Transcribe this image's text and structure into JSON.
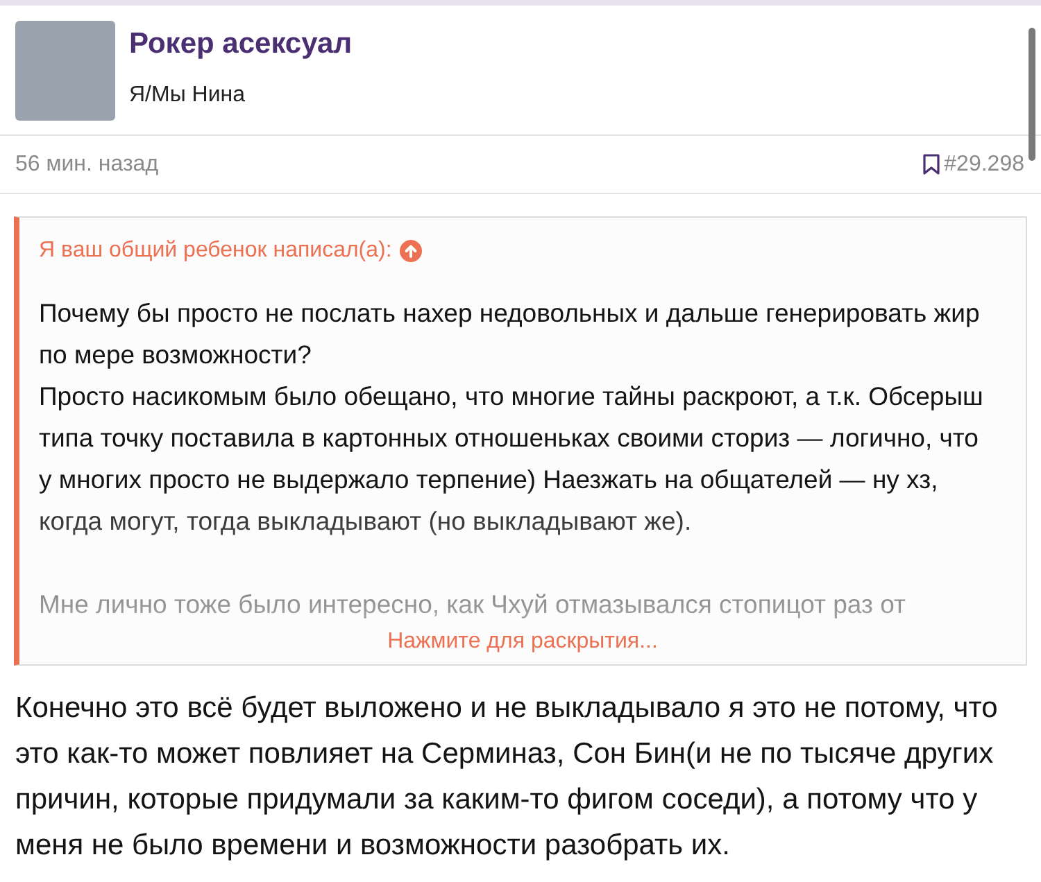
{
  "author": {
    "name": "Рокер асексуал",
    "title": "Я/Мы Нина"
  },
  "meta": {
    "time": "56 мин. назад",
    "post_number": "#29.298"
  },
  "quote": {
    "attribution": "Я ваш общий ребенок написал(а):",
    "paragraphs": [
      [
        "Почему бы просто не послать нахер недовольных и дальше генерировать жир по мере возможности?",
        "Просто насикомым было обещано, что многие тайны раскроют, а т.к. Обсерыш типа точку поставила в картонных отношеньках своими сториз — логично, что у многих просто не выдержало терпение) Наезжать на общателей — ну хз, когда могут, тогда выкладывают (но выкладывают же)."
      ],
      [
        "Мне лично тоже было интересно, как Чхуй отмазывался стопицот раз от"
      ]
    ],
    "expand": "Нажмите для раскрытия..."
  },
  "body": "Конечно это всё будет выложено и не выкладывало я это не потому, что это как-то может повлияет на Серминаз, Сон Бин(и не по тысяче других причин, которые придумали за каким-то фигом соседи), а потому что у меня не было времени и возможности разобрать их."
}
